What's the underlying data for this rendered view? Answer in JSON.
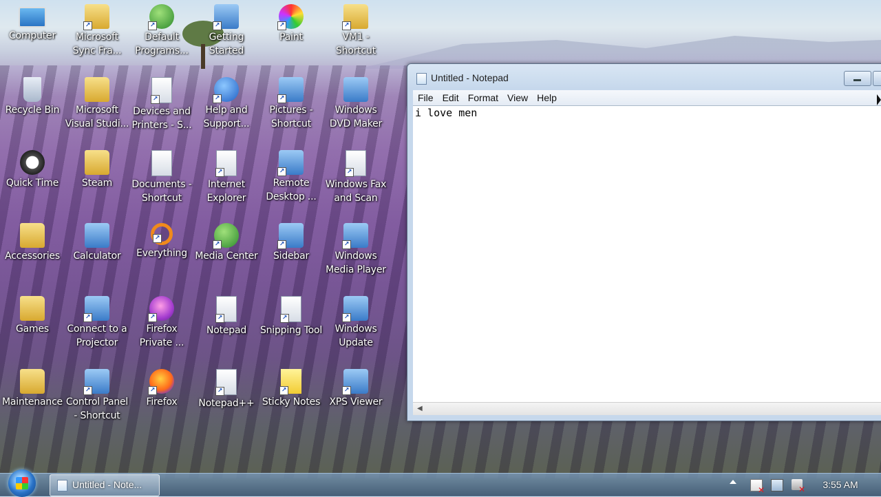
{
  "desktop_icons": [
    {
      "label": "Computer",
      "icon": "computer-icon"
    },
    {
      "label": "Microsoft Sync Fra...",
      "icon": "folder-shortcut-icon"
    },
    {
      "label": "Default Programs...",
      "icon": "default-programs-icon"
    },
    {
      "label": "Getting Started",
      "icon": "getting-started-icon"
    },
    {
      "label": "Paint",
      "icon": "paint-icon"
    },
    {
      "label": "VM1 - Shortcut",
      "icon": "folder-shortcut-icon"
    },
    {
      "label": "Recycle Bin",
      "icon": "recycle-bin-icon"
    },
    {
      "label": "Microsoft Visual Studi...",
      "icon": "folder-help-icon"
    },
    {
      "label": "Devices and Printers - S...",
      "icon": "printer-icon"
    },
    {
      "label": "Help and Support...",
      "icon": "help-icon"
    },
    {
      "label": "Pictures - Shortcut",
      "icon": "pictures-icon"
    },
    {
      "label": "Windows DVD Maker",
      "icon": "dvd-maker-icon"
    },
    {
      "label": "Quick Time",
      "icon": "clock-icon"
    },
    {
      "label": "Steam",
      "icon": "folder-icon"
    },
    {
      "label": "Documents - Shortcut",
      "icon": "documents-icon"
    },
    {
      "label": "Internet Explorer",
      "icon": "internet-explorer-icon"
    },
    {
      "label": "Remote Desktop ...",
      "icon": "remote-desktop-icon"
    },
    {
      "label": "Windows Fax and Scan",
      "icon": "fax-icon"
    },
    {
      "label": "Accessories",
      "icon": "folder-icon"
    },
    {
      "label": "Calculator",
      "icon": "calculator-icon"
    },
    {
      "label": "Everything",
      "icon": "search-icon"
    },
    {
      "label": "Media Center",
      "icon": "media-center-icon"
    },
    {
      "label": "Sidebar",
      "icon": "sidebar-icon"
    },
    {
      "label": "Windows Media Player",
      "icon": "media-player-icon"
    },
    {
      "label": "Games",
      "icon": "folder-icon"
    },
    {
      "label": "Connect to a Projector",
      "icon": "projector-icon"
    },
    {
      "label": "Firefox Private ...",
      "icon": "firefox-private-icon"
    },
    {
      "label": "Notepad",
      "icon": "notepad-icon"
    },
    {
      "label": "Snipping Tool",
      "icon": "scissors-icon"
    },
    {
      "label": "Windows Update",
      "icon": "windows-update-icon"
    },
    {
      "label": "Maintenance",
      "icon": "folder-icon"
    },
    {
      "label": "Control Panel - Shortcut",
      "icon": "control-panel-icon"
    },
    {
      "label": "Firefox",
      "icon": "firefox-icon"
    },
    {
      "label": "Notepad++",
      "icon": "notepad-plus-icon"
    },
    {
      "label": "Sticky Notes",
      "icon": "sticky-notes-icon"
    },
    {
      "label": "XPS Viewer",
      "icon": "xps-viewer-icon"
    }
  ],
  "notepad": {
    "title": "Untitled - Notepad",
    "menu": [
      "File",
      "Edit",
      "Format",
      "View",
      "Help"
    ],
    "content": "i love men"
  },
  "taskbar": {
    "start_icon": "windows-start-icon",
    "items": [
      {
        "label": "Untitled - Note...",
        "icon": "notepad-icon"
      }
    ],
    "tray_icons": [
      "show-hidden-icons-icon",
      "action-center-icon",
      "network-icon",
      "volume-icon"
    ],
    "clock": "3:55 AM"
  }
}
